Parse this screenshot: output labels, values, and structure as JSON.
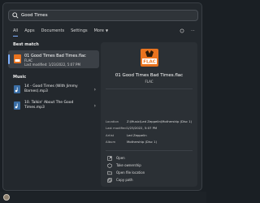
{
  "search": {
    "value": "Good Times"
  },
  "tabs": [
    {
      "label": "All"
    },
    {
      "label": "Apps"
    },
    {
      "label": "Documents"
    },
    {
      "label": "Settings"
    },
    {
      "label": "More"
    }
  ],
  "best_match": {
    "section_title": "Best match",
    "title": "01 Good Times Bad Times.flac",
    "type": "FLAC",
    "modified": "Last modified: 1/23/2022, 5:07 PM"
  },
  "music": {
    "section_title": "Music",
    "items": [
      {
        "title": "14 - Good Times (With Jimmy Barnes).mp3"
      },
      {
        "title": "10. Talkin' About The Good Times.mp3"
      }
    ]
  },
  "preview": {
    "icon_label": "FLAC",
    "title": "01 Good Times Bad Times.flac",
    "subtitle": "FLAC",
    "properties": [
      {
        "key": "Location",
        "value": "Z:\\Music\\Led Zeppelin\\Mothership (Disc 1)"
      },
      {
        "key": "Last modified",
        "value": "1/23/2022, 5:07 PM"
      },
      {
        "key": "Artist",
        "value": "Led Zeppelin"
      },
      {
        "key": "Album",
        "value": "Mothership (Disc 1)"
      }
    ],
    "actions": [
      {
        "label": "Open",
        "icon": "open-icon"
      },
      {
        "label": "Take ownership",
        "icon": "ownership-icon"
      },
      {
        "label": "Open file location",
        "icon": "folder-icon"
      },
      {
        "label": "Copy path",
        "icon": "copy-icon"
      }
    ]
  },
  "colors": {
    "accent": "#7fb1ff",
    "flac_orange": "#e8731f"
  }
}
